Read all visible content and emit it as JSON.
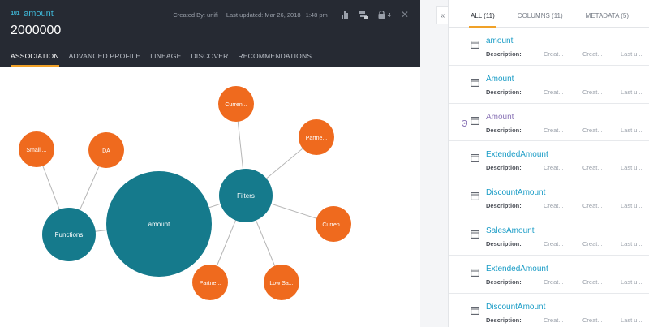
{
  "header": {
    "type_icon": "101",
    "title": "amount",
    "value": "2000000",
    "created_by": "Created By: unifi",
    "last_updated": "Last updated: Mar 26, 2018 | 1:48 pm",
    "lock_count": "4"
  },
  "tabs": [
    "ASSOCIATION",
    "ADVANCED PROFILE",
    "LINEAGE",
    "DISCOVER",
    "RECOMMENDATIONS"
  ],
  "graph": {
    "nodes": {
      "amount": "amount",
      "functions": "Functions",
      "filters": "Filters",
      "small": "Small ...",
      "da": "DA",
      "curren1": "Curren...",
      "partne1": "Partne...",
      "curren2": "Curren...",
      "low": "Low Sa...",
      "partne2": "Partne..."
    },
    "colors": {
      "teal": "#157a8c",
      "orange": "#ef6a1e",
      "edge": "#b5b5b5"
    }
  },
  "right": {
    "collapse_glyph": "«",
    "tabs": [
      "ALL (11)",
      "COLUMNS (11)",
      "METADATA (5)"
    ],
    "items": [
      {
        "name": "amount",
        "desc": "Description:",
        "c1": "Creat...",
        "c2": "Creat...",
        "c3": "Last u..."
      },
      {
        "name": "Amount",
        "desc": "Description:",
        "c1": "Creat...",
        "c2": "Creat...",
        "c3": "Last u..."
      },
      {
        "name": "Amount",
        "desc": "Description:",
        "c1": "Creat...",
        "c2": "Creat...",
        "c3": "Last u..."
      },
      {
        "name": "ExtendedAmount",
        "desc": "Description:",
        "c1": "Creat...",
        "c2": "Creat...",
        "c3": "Last u..."
      },
      {
        "name": "DiscountAmount",
        "desc": "Description:",
        "c1": "Creat...",
        "c2": "Creat...",
        "c3": "Last u..."
      },
      {
        "name": "SalesAmount",
        "desc": "Description:",
        "c1": "Creat...",
        "c2": "Creat...",
        "c3": "Last u..."
      },
      {
        "name": "ExtendedAmount",
        "desc": "Description:",
        "c1": "Creat...",
        "c2": "Creat...",
        "c3": "Last u..."
      },
      {
        "name": "DiscountAmount",
        "desc": "Description:",
        "c1": "Creat...",
        "c2": "Creat...",
        "c3": "Last u..."
      }
    ]
  }
}
